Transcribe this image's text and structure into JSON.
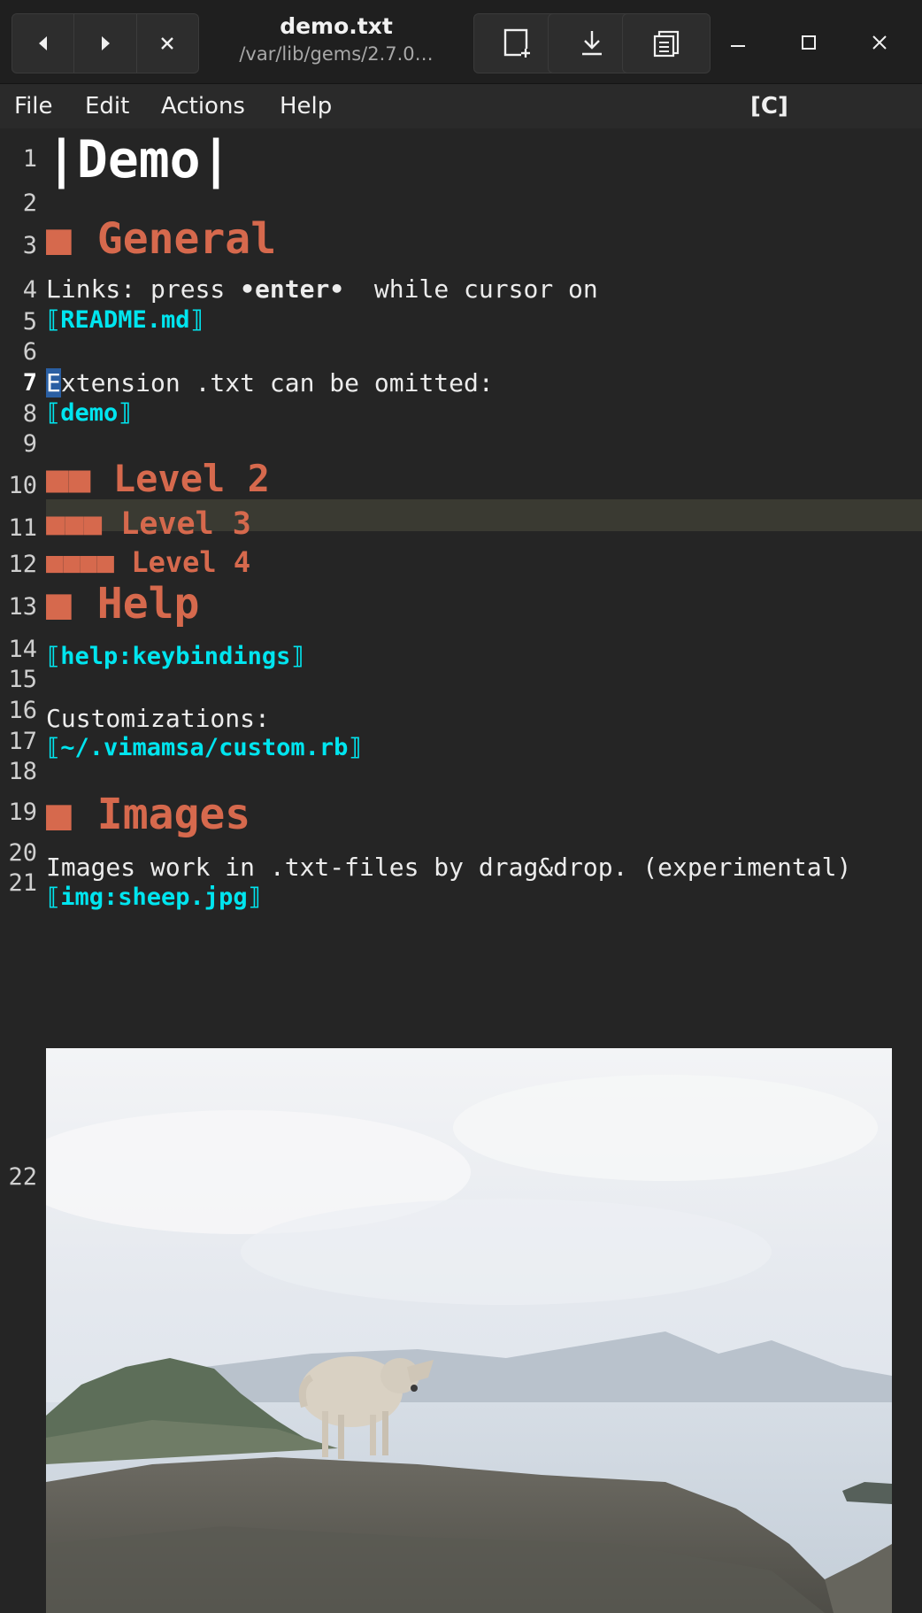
{
  "window": {
    "title": "demo.txt",
    "subtitle": "/var/lib/gems/2.7.0…"
  },
  "nav": {
    "back_icon": "triangle-left-icon",
    "forward_icon": "triangle-right-icon",
    "close_icon": "x-icon"
  },
  "toolbar": {
    "new_file_icon": "new-document-icon",
    "save_icon": "download-icon",
    "open_icon": "documents-icon"
  },
  "window_controls": {
    "minimize_icon": "minimize-icon",
    "maximize_icon": "maximize-icon",
    "close_icon": "close-icon"
  },
  "menu": {
    "items": [
      "File",
      "Edit",
      "Actions",
      "Help"
    ],
    "mode": "[C]"
  },
  "editor": {
    "current_line": 7,
    "lines": [
      {
        "n": "1",
        "text": "|Demo|"
      },
      {
        "n": "2",
        "text": ""
      },
      {
        "n": "3",
        "text": "■ General"
      },
      {
        "n": "4",
        "pre": "Links: press ",
        "bold": "•enter•",
        "post": "  while cursor on"
      },
      {
        "n": "5",
        "text": "⟦README.md⟧"
      },
      {
        "n": "6",
        "text": ""
      },
      {
        "n": "7",
        "cursor": "E",
        "text": "xtension .txt can be omitted:"
      },
      {
        "n": "8",
        "text": "⟦demo⟧"
      },
      {
        "n": "9",
        "text": ""
      },
      {
        "n": "10",
        "text": "■■ Level 2"
      },
      {
        "n": "11",
        "text": "■■■ Level 3"
      },
      {
        "n": "12",
        "text": "■■■■ Level 4"
      },
      {
        "n": "13",
        "text": "■ Help"
      },
      {
        "n": "14",
        "text": "⟦help:keybindings⟧"
      },
      {
        "n": "15",
        "text": ""
      },
      {
        "n": "16",
        "text": "Customizations:"
      },
      {
        "n": "17",
        "text": "⟦~/.vimamsa/custom.rb⟧"
      },
      {
        "n": "18",
        "text": ""
      },
      {
        "n": "19",
        "text": "■ Images"
      },
      {
        "n": "20",
        "text": "Images work in .txt-files by drag&drop. (experimental)"
      },
      {
        "n": "21",
        "text": "⟦img:sheep.jpg⟧"
      },
      {
        "n": "22",
        "text": ""
      }
    ],
    "image": {
      "name": "sheep-photo",
      "alt": "sheep.jpg"
    }
  },
  "colors": {
    "background": "#252525",
    "heading": "#d6694d",
    "link": "#00e5ef",
    "current_line": "#3a3a32",
    "cursor": "#2a5fa3"
  }
}
